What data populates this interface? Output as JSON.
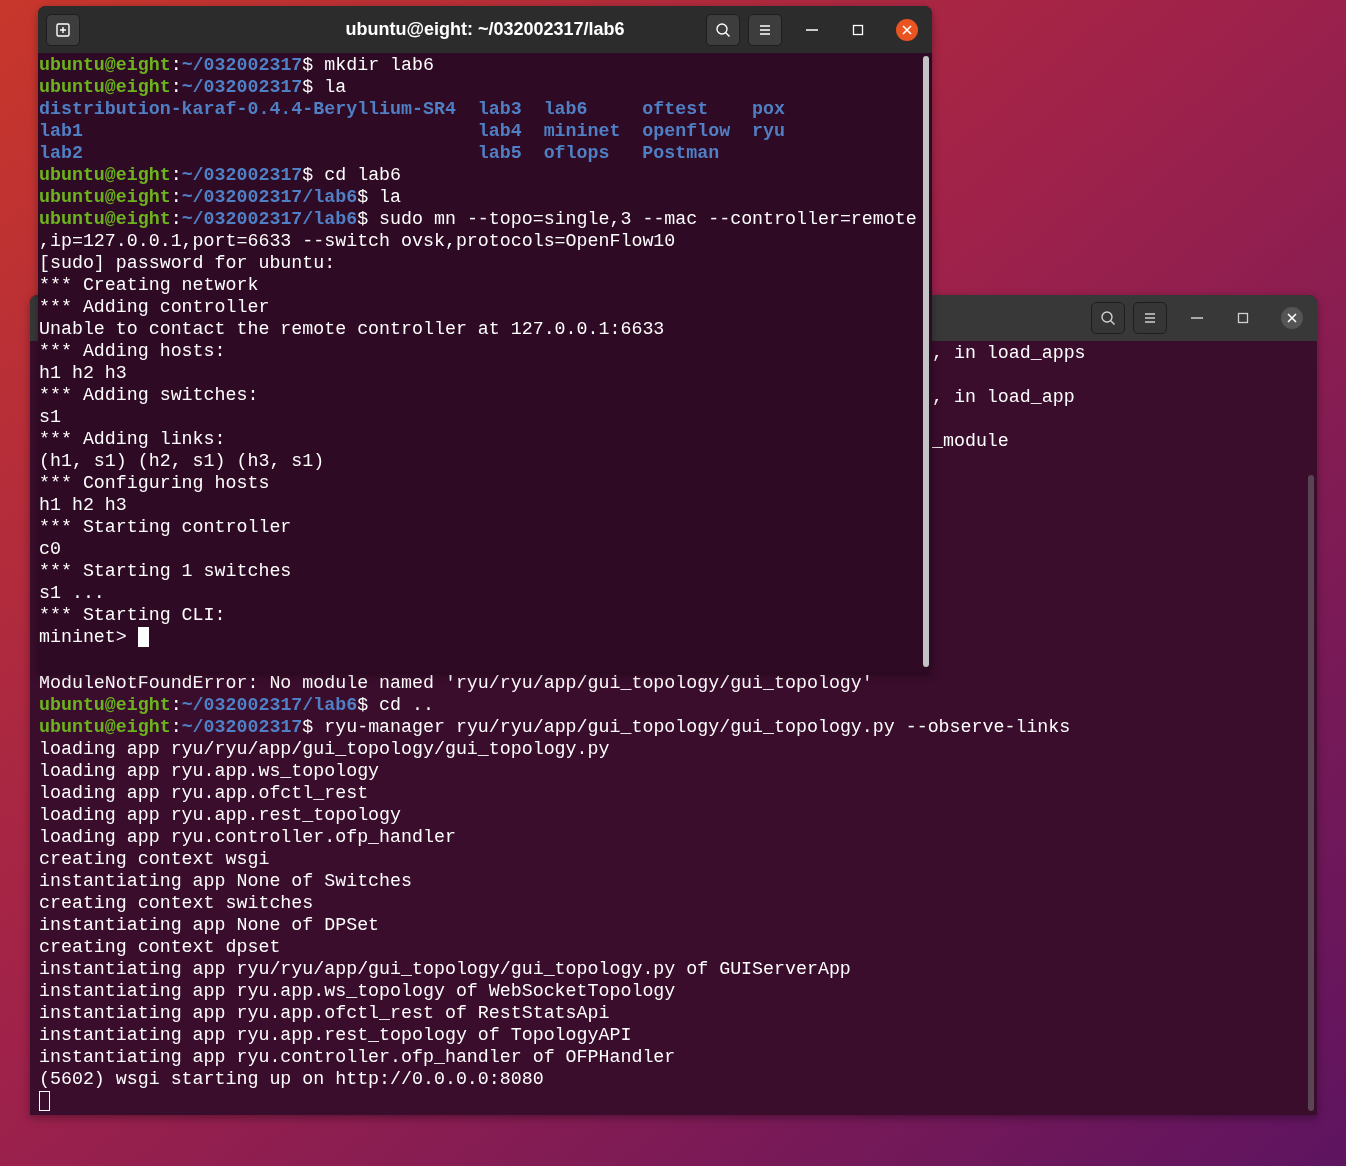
{
  "windows": [
    {
      "kind": "front",
      "active": true,
      "title": "ubuntu@eight: ~/032002317/lab6",
      "lines": [
        {
          "kind": "text",
          "segments": [
            {
              "kind": "user",
              "text": "ubuntu@eight"
            },
            {
              "kind": "plain",
              "text": ":"
            },
            {
              "kind": "path",
              "text": "~/032002317"
            },
            {
              "kind": "plain",
              "text": "$ mkdir lab6"
            }
          ]
        },
        {
          "kind": "text",
          "segments": [
            {
              "kind": "user",
              "text": "ubuntu@eight"
            },
            {
              "kind": "plain",
              "text": ":"
            },
            {
              "kind": "path",
              "text": "~/032002317"
            },
            {
              "kind": "plain",
              "text": "$ la"
            }
          ]
        },
        {
          "kind": "listing",
          "columns": [
            [
              "distribution-karaf-0.4.4-Beryllium-SR4",
              "lab1",
              "lab2"
            ],
            [
              "lab3",
              "lab4",
              "lab5"
            ],
            [
              "lab6",
              "mininet",
              "oflops"
            ],
            [
              "oftest",
              "openflow",
              "Postman"
            ],
            [
              "pox",
              "ryu"
            ]
          ]
        },
        {
          "kind": "text",
          "segments": [
            {
              "kind": "user",
              "text": "ubuntu@eight"
            },
            {
              "kind": "plain",
              "text": ":"
            },
            {
              "kind": "path",
              "text": "~/032002317"
            },
            {
              "kind": "plain",
              "text": "$ cd lab6"
            }
          ]
        },
        {
          "kind": "text",
          "segments": [
            {
              "kind": "user",
              "text": "ubuntu@eight"
            },
            {
              "kind": "plain",
              "text": ":"
            },
            {
              "kind": "path",
              "text": "~/032002317/lab6"
            },
            {
              "kind": "plain",
              "text": "$ la"
            }
          ]
        },
        {
          "kind": "text",
          "segments": [
            {
              "kind": "user",
              "text": "ubuntu@eight"
            },
            {
              "kind": "plain",
              "text": ":"
            },
            {
              "kind": "path",
              "text": "~/032002317/lab6"
            },
            {
              "kind": "plain",
              "text": "$ sudo mn --topo=single,3 --mac --controller=remote"
            }
          ]
        },
        {
          "kind": "text",
          "segments": [
            {
              "kind": "plain",
              "text": ",ip=127.0.0.1,port=6633 --switch ovsk,protocols=OpenFlow10"
            }
          ]
        },
        {
          "kind": "text",
          "segments": [
            {
              "kind": "plain",
              "text": "[sudo] password for ubuntu:"
            }
          ]
        },
        {
          "kind": "text",
          "segments": [
            {
              "kind": "plain",
              "text": "*** Creating network"
            }
          ]
        },
        {
          "kind": "text",
          "segments": [
            {
              "kind": "plain",
              "text": "*** Adding controller"
            }
          ]
        },
        {
          "kind": "text",
          "segments": [
            {
              "kind": "plain",
              "text": "Unable to contact the remote controller at 127.0.0.1:6633"
            }
          ]
        },
        {
          "kind": "text",
          "segments": [
            {
              "kind": "plain",
              "text": "*** Adding hosts:"
            }
          ]
        },
        {
          "kind": "text",
          "segments": [
            {
              "kind": "plain",
              "text": "h1 h2 h3"
            }
          ]
        },
        {
          "kind": "text",
          "segments": [
            {
              "kind": "plain",
              "text": "*** Adding switches:"
            }
          ]
        },
        {
          "kind": "text",
          "segments": [
            {
              "kind": "plain",
              "text": "s1"
            }
          ]
        },
        {
          "kind": "text",
          "segments": [
            {
              "kind": "plain",
              "text": "*** Adding links:"
            }
          ]
        },
        {
          "kind": "text",
          "segments": [
            {
              "kind": "plain",
              "text": "(h1, s1) (h2, s1) (h3, s1)"
            }
          ]
        },
        {
          "kind": "text",
          "segments": [
            {
              "kind": "plain",
              "text": "*** Configuring hosts"
            }
          ]
        },
        {
          "kind": "text",
          "segments": [
            {
              "kind": "plain",
              "text": "h1 h2 h3"
            }
          ]
        },
        {
          "kind": "text",
          "segments": [
            {
              "kind": "plain",
              "text": "*** Starting controller"
            }
          ]
        },
        {
          "kind": "text",
          "segments": [
            {
              "kind": "plain",
              "text": "c0"
            }
          ]
        },
        {
          "kind": "text",
          "segments": [
            {
              "kind": "plain",
              "text": "*** Starting 1 switches"
            }
          ]
        },
        {
          "kind": "text",
          "segments": [
            {
              "kind": "plain",
              "text": "s1 ..."
            }
          ]
        },
        {
          "kind": "text",
          "segments": [
            {
              "kind": "plain",
              "text": "*** Starting CLI:"
            }
          ]
        },
        {
          "kind": "text",
          "cursor": true,
          "segments": [
            {
              "kind": "plain",
              "text": "mininet> "
            }
          ]
        }
      ]
    },
    {
      "kind": "back",
      "active": false,
      "lines": [
        {
          "kind": "partial",
          "segments": [
            {
              "kind": "plain",
              "text": ", in load_apps"
            }
          ]
        },
        {
          "kind": "blank"
        },
        {
          "kind": "partial",
          "segments": [
            {
              "kind": "plain",
              "text": ", in load_app"
            }
          ]
        },
        {
          "kind": "blank"
        },
        {
          "kind": "partial",
          "segments": [
            {
              "kind": "plain",
              "text": "_module"
            }
          ]
        },
        {
          "kind": "blank"
        },
        {
          "kind": "blank"
        },
        {
          "kind": "blank"
        },
        {
          "kind": "blank"
        },
        {
          "kind": "blank"
        },
        {
          "kind": "blank"
        },
        {
          "kind": "blank"
        },
        {
          "kind": "blank"
        },
        {
          "kind": "blank"
        },
        {
          "kind": "blank"
        },
        {
          "kind": "text",
          "segments": [
            {
              "kind": "plain",
              "text": "ModuleNotFoundError: No module named 'ryu/ryu/app/gui_topology/gui_topology'"
            }
          ]
        },
        {
          "kind": "text",
          "segments": [
            {
              "kind": "user",
              "text": "ubuntu@eight"
            },
            {
              "kind": "plain",
              "text": ":"
            },
            {
              "kind": "path",
              "text": "~/032002317/lab6"
            },
            {
              "kind": "plain",
              "text": "$ cd .."
            }
          ]
        },
        {
          "kind": "text",
          "segments": [
            {
              "kind": "user",
              "text": "ubuntu@eight"
            },
            {
              "kind": "plain",
              "text": ":"
            },
            {
              "kind": "path",
              "text": "~/032002317"
            },
            {
              "kind": "plain",
              "text": "$ ryu-manager ryu/ryu/app/gui_topology/gui_topology.py --observe-links"
            }
          ]
        },
        {
          "kind": "text",
          "segments": [
            {
              "kind": "plain",
              "text": "loading app ryu/ryu/app/gui_topology/gui_topology.py"
            }
          ]
        },
        {
          "kind": "text",
          "segments": [
            {
              "kind": "plain",
              "text": "loading app ryu.app.ws_topology"
            }
          ]
        },
        {
          "kind": "text",
          "segments": [
            {
              "kind": "plain",
              "text": "loading app ryu.app.ofctl_rest"
            }
          ]
        },
        {
          "kind": "text",
          "segments": [
            {
              "kind": "plain",
              "text": "loading app ryu.app.rest_topology"
            }
          ]
        },
        {
          "kind": "text",
          "segments": [
            {
              "kind": "plain",
              "text": "loading app ryu.controller.ofp_handler"
            }
          ]
        },
        {
          "kind": "text",
          "segments": [
            {
              "kind": "plain",
              "text": "creating context wsgi"
            }
          ]
        },
        {
          "kind": "text",
          "segments": [
            {
              "kind": "plain",
              "text": "instantiating app None of Switches"
            }
          ]
        },
        {
          "kind": "text",
          "segments": [
            {
              "kind": "plain",
              "text": "creating context switches"
            }
          ]
        },
        {
          "kind": "text",
          "segments": [
            {
              "kind": "plain",
              "text": "instantiating app None of DPSet"
            }
          ]
        },
        {
          "kind": "text",
          "segments": [
            {
              "kind": "plain",
              "text": "creating context dpset"
            }
          ]
        },
        {
          "kind": "text",
          "segments": [
            {
              "kind": "plain",
              "text": "instantiating app ryu/ryu/app/gui_topology/gui_topology.py of GUIServerApp"
            }
          ]
        },
        {
          "kind": "text",
          "segments": [
            {
              "kind": "plain",
              "text": "instantiating app ryu.app.ws_topology of WebSocketTopology"
            }
          ]
        },
        {
          "kind": "text",
          "segments": [
            {
              "kind": "plain",
              "text": "instantiating app ryu.app.ofctl_rest of RestStatsApi"
            }
          ]
        },
        {
          "kind": "text",
          "segments": [
            {
              "kind": "plain",
              "text": "instantiating app ryu.app.rest_topology of TopologyAPI"
            }
          ]
        },
        {
          "kind": "text",
          "segments": [
            {
              "kind": "plain",
              "text": "instantiating app ryu.controller.ofp_handler of OFPHandler"
            }
          ]
        },
        {
          "kind": "text",
          "segments": [
            {
              "kind": "plain",
              "text": "(5602) wsgi starting up on http://0.0.0.0:8080"
            }
          ]
        },
        {
          "kind": "blank",
          "cursor": true
        }
      ]
    }
  ]
}
